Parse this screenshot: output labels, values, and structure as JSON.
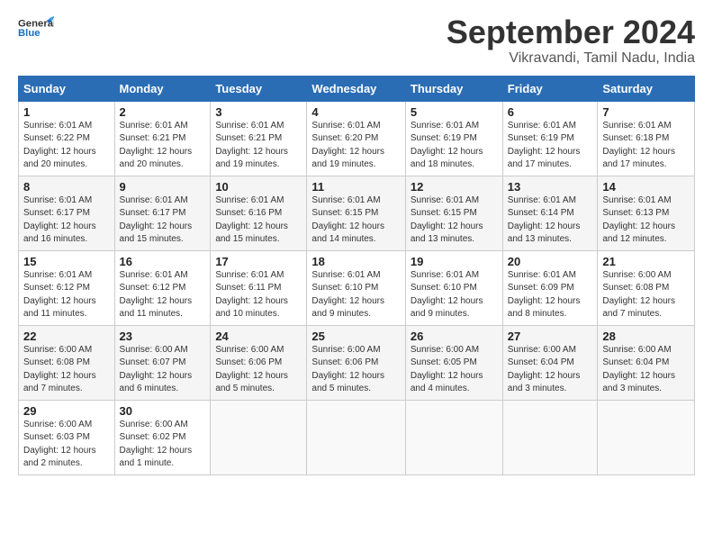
{
  "header": {
    "logo_line1": "General",
    "logo_line2": "Blue",
    "main_title": "September 2024",
    "sub_title": "Vikravandi, Tamil Nadu, India"
  },
  "calendar": {
    "columns": [
      "Sunday",
      "Monday",
      "Tuesday",
      "Wednesday",
      "Thursday",
      "Friday",
      "Saturday"
    ],
    "rows": [
      [
        {
          "day": "1",
          "info": "Sunrise: 6:01 AM\nSunset: 6:22 PM\nDaylight: 12 hours\nand 20 minutes."
        },
        {
          "day": "2",
          "info": "Sunrise: 6:01 AM\nSunset: 6:21 PM\nDaylight: 12 hours\nand 20 minutes."
        },
        {
          "day": "3",
          "info": "Sunrise: 6:01 AM\nSunset: 6:21 PM\nDaylight: 12 hours\nand 19 minutes."
        },
        {
          "day": "4",
          "info": "Sunrise: 6:01 AM\nSunset: 6:20 PM\nDaylight: 12 hours\nand 19 minutes."
        },
        {
          "day": "5",
          "info": "Sunrise: 6:01 AM\nSunset: 6:19 PM\nDaylight: 12 hours\nand 18 minutes."
        },
        {
          "day": "6",
          "info": "Sunrise: 6:01 AM\nSunset: 6:19 PM\nDaylight: 12 hours\nand 17 minutes."
        },
        {
          "day": "7",
          "info": "Sunrise: 6:01 AM\nSunset: 6:18 PM\nDaylight: 12 hours\nand 17 minutes."
        }
      ],
      [
        {
          "day": "8",
          "info": "Sunrise: 6:01 AM\nSunset: 6:17 PM\nDaylight: 12 hours\nand 16 minutes."
        },
        {
          "day": "9",
          "info": "Sunrise: 6:01 AM\nSunset: 6:17 PM\nDaylight: 12 hours\nand 15 minutes."
        },
        {
          "day": "10",
          "info": "Sunrise: 6:01 AM\nSunset: 6:16 PM\nDaylight: 12 hours\nand 15 minutes."
        },
        {
          "day": "11",
          "info": "Sunrise: 6:01 AM\nSunset: 6:15 PM\nDaylight: 12 hours\nand 14 minutes."
        },
        {
          "day": "12",
          "info": "Sunrise: 6:01 AM\nSunset: 6:15 PM\nDaylight: 12 hours\nand 13 minutes."
        },
        {
          "day": "13",
          "info": "Sunrise: 6:01 AM\nSunset: 6:14 PM\nDaylight: 12 hours\nand 13 minutes."
        },
        {
          "day": "14",
          "info": "Sunrise: 6:01 AM\nSunset: 6:13 PM\nDaylight: 12 hours\nand 12 minutes."
        }
      ],
      [
        {
          "day": "15",
          "info": "Sunrise: 6:01 AM\nSunset: 6:12 PM\nDaylight: 12 hours\nand 11 minutes."
        },
        {
          "day": "16",
          "info": "Sunrise: 6:01 AM\nSunset: 6:12 PM\nDaylight: 12 hours\nand 11 minutes."
        },
        {
          "day": "17",
          "info": "Sunrise: 6:01 AM\nSunset: 6:11 PM\nDaylight: 12 hours\nand 10 minutes."
        },
        {
          "day": "18",
          "info": "Sunrise: 6:01 AM\nSunset: 6:10 PM\nDaylight: 12 hours\nand 9 minutes."
        },
        {
          "day": "19",
          "info": "Sunrise: 6:01 AM\nSunset: 6:10 PM\nDaylight: 12 hours\nand 9 minutes."
        },
        {
          "day": "20",
          "info": "Sunrise: 6:01 AM\nSunset: 6:09 PM\nDaylight: 12 hours\nand 8 minutes."
        },
        {
          "day": "21",
          "info": "Sunrise: 6:00 AM\nSunset: 6:08 PM\nDaylight: 12 hours\nand 7 minutes."
        }
      ],
      [
        {
          "day": "22",
          "info": "Sunrise: 6:00 AM\nSunset: 6:08 PM\nDaylight: 12 hours\nand 7 minutes."
        },
        {
          "day": "23",
          "info": "Sunrise: 6:00 AM\nSunset: 6:07 PM\nDaylight: 12 hours\nand 6 minutes."
        },
        {
          "day": "24",
          "info": "Sunrise: 6:00 AM\nSunset: 6:06 PM\nDaylight: 12 hours\nand 5 minutes."
        },
        {
          "day": "25",
          "info": "Sunrise: 6:00 AM\nSunset: 6:06 PM\nDaylight: 12 hours\nand 5 minutes."
        },
        {
          "day": "26",
          "info": "Sunrise: 6:00 AM\nSunset: 6:05 PM\nDaylight: 12 hours\nand 4 minutes."
        },
        {
          "day": "27",
          "info": "Sunrise: 6:00 AM\nSunset: 6:04 PM\nDaylight: 12 hours\nand 3 minutes."
        },
        {
          "day": "28",
          "info": "Sunrise: 6:00 AM\nSunset: 6:04 PM\nDaylight: 12 hours\nand 3 minutes."
        }
      ],
      [
        {
          "day": "29",
          "info": "Sunrise: 6:00 AM\nSunset: 6:03 PM\nDaylight: 12 hours\nand 2 minutes."
        },
        {
          "day": "30",
          "info": "Sunrise: 6:00 AM\nSunset: 6:02 PM\nDaylight: 12 hours\nand 1 minute."
        },
        {
          "day": "",
          "info": ""
        },
        {
          "day": "",
          "info": ""
        },
        {
          "day": "",
          "info": ""
        },
        {
          "day": "",
          "info": ""
        },
        {
          "day": "",
          "info": ""
        }
      ]
    ]
  }
}
